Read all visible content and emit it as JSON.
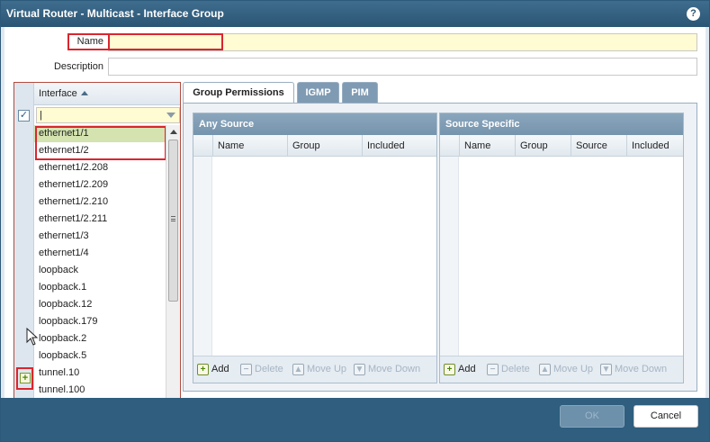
{
  "window": {
    "title": "Virtual Router - Multicast - Interface Group",
    "help_icon": "?"
  },
  "form": {
    "name_label": "Name",
    "name_value": "",
    "description_label": "Description",
    "description_value": ""
  },
  "interface_list": {
    "column_header": "Interface",
    "filter_value": "",
    "items": [
      {
        "label": "ethernet1/1",
        "selected": true
      },
      {
        "label": "ethernet1/2",
        "selected": false
      },
      {
        "label": "ethernet1/2.208",
        "selected": false
      },
      {
        "label": "ethernet1/2.209",
        "selected": false
      },
      {
        "label": "ethernet1/2.210",
        "selected": false
      },
      {
        "label": "ethernet1/2.211",
        "selected": false
      },
      {
        "label": "ethernet1/3",
        "selected": false
      },
      {
        "label": "ethernet1/4",
        "selected": false
      },
      {
        "label": "loopback",
        "selected": false
      },
      {
        "label": "loopback.1",
        "selected": false
      },
      {
        "label": "loopback.12",
        "selected": false
      },
      {
        "label": "loopback.179",
        "selected": false
      },
      {
        "label": "loopback.2",
        "selected": false
      },
      {
        "label": "loopback.5",
        "selected": false
      },
      {
        "label": "tunnel.10",
        "selected": false
      },
      {
        "label": "tunnel.100",
        "selected": false
      }
    ]
  },
  "tabs": [
    {
      "label": "Group Permissions",
      "active": true
    },
    {
      "label": "IGMP",
      "active": false
    },
    {
      "label": "PIM",
      "active": false
    }
  ],
  "any_source": {
    "title": "Any Source",
    "columns": [
      "Name",
      "Group",
      "Included"
    ]
  },
  "source_specific": {
    "title": "Source Specific",
    "columns": [
      "Name",
      "Group",
      "Source",
      "Included"
    ]
  },
  "grid_tools": {
    "add": "Add",
    "delete": "Delete",
    "move_up": "Move Up",
    "move_down": "Move Down"
  },
  "footer": {
    "ok_label": "OK",
    "cancel_label": "Cancel"
  },
  "colors": {
    "title_bar": "#2b5574",
    "highlight_red": "#d9262e",
    "input_yellow": "#fffbd2",
    "selected_row": "#d4e3b0"
  }
}
